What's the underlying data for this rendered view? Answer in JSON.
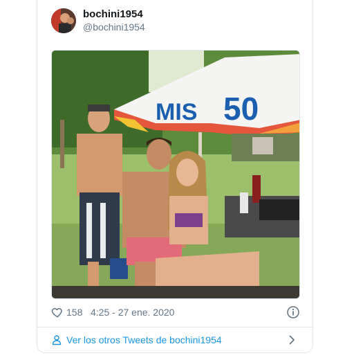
{
  "tweet": {
    "author": {
      "display_name": "bochini1954",
      "handle": "@bochini1954",
      "avatar_icon": "user-avatar"
    },
    "media": {
      "banner_text_1": "MIS",
      "banner_text_2": "50",
      "banner_text_color": "#1c5fb0"
    },
    "likes": "158",
    "timestamp": "4:25 - 27 ene. 2020",
    "more_tweets_label": "Ver los otros Tweets de bochini1954"
  },
  "colors": {
    "link": "#1b95e0",
    "muted": "#657786",
    "border": "#e1e8ed"
  }
}
